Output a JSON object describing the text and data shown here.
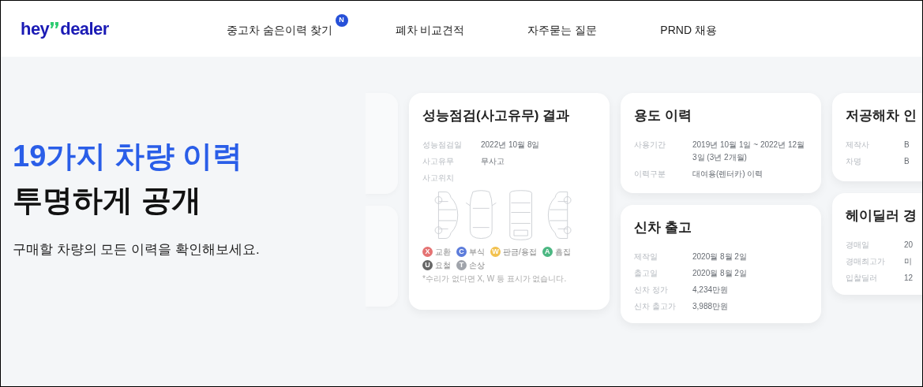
{
  "header": {
    "logo": {
      "left": "hey",
      "right": "dealer"
    },
    "nav": [
      {
        "label": "중고차 숨은이력 찾기",
        "badge": "N"
      },
      {
        "label": "폐차 비교견적"
      },
      {
        "label": "자주묻는 질문"
      },
      {
        "label": "PRND 채용"
      }
    ]
  },
  "hero": {
    "title_highlight": "19가지 차량 이력",
    "title": "투명하게 공개",
    "subtitle": "구매할 차량의 모든 이력을 확인해보세요."
  },
  "inspection_card": {
    "title": "성능점검(사고유무) 결과",
    "rows": [
      {
        "label": "성능점검일",
        "value": "2022년 10월 8일"
      },
      {
        "label": "사고유무",
        "value": "무사고"
      },
      {
        "label": "사고위치"
      }
    ],
    "legend": [
      {
        "letter": "X",
        "label": "교환",
        "color": "#e57373"
      },
      {
        "letter": "C",
        "label": "부식",
        "color": "#5c7cdb"
      },
      {
        "letter": "W",
        "label": "판금/용접",
        "color": "#f2c14e"
      },
      {
        "letter": "A",
        "label": "흠집",
        "color": "#4cb782"
      },
      {
        "letter": "U",
        "label": "요철",
        "color": "#666666"
      },
      {
        "letter": "T",
        "label": "손상",
        "color": "#a0a4ab"
      }
    ],
    "note": "*수리가 없다면 X, W 등 표시가 없습니다."
  },
  "columns": [
    [
      {
        "title": "용도 이력",
        "rows": [
          {
            "label": "사용기간",
            "value": "2019년 10월 1일 ~ 2022년 12월 3일 (3년 2개월)"
          },
          {
            "label": "이력구분",
            "value": "대여용(렌터카) 이력"
          }
        ]
      },
      {
        "title": "신차 출고",
        "rows": [
          {
            "label": "제작일",
            "value": "2020월 8월 2일"
          },
          {
            "label": "출고일",
            "value": "2020월 8월 2일"
          },
          {
            "label": "신차 정가",
            "value": "4,234만원"
          },
          {
            "label": "신차 출고가",
            "value": "3,988만원"
          }
        ]
      }
    ],
    [
      {
        "title": "저공해차 인",
        "rows": [
          {
            "label": "제작사",
            "value": "B"
          },
          {
            "label": "차명",
            "value": "B"
          }
        ]
      },
      {
        "title": "헤이딜러 경",
        "rows": [
          {
            "label": "경매일",
            "value": "20"
          },
          {
            "label": "경매최고가",
            "value": "미"
          },
          {
            "label": "입찰딜러",
            "value": "12"
          }
        ]
      }
    ]
  ]
}
